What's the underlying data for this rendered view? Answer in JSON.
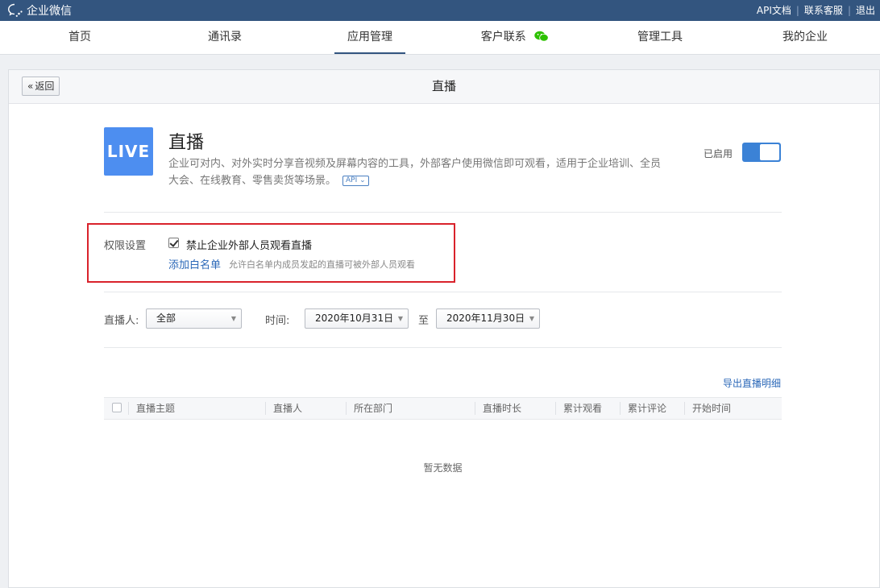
{
  "topbar": {
    "brand": "企业微信",
    "links": [
      "API文档",
      "联系客服",
      "退出"
    ]
  },
  "nav": {
    "items": [
      "首页",
      "通讯录",
      "应用管理",
      "客户联系",
      "管理工具",
      "我的企业"
    ],
    "active": "应用管理"
  },
  "header": {
    "back_label": "返回",
    "title": "直播"
  },
  "app": {
    "icon_text": "LIVE",
    "name": "直播",
    "description": "企业可对内、对外实时分享音视频及屏幕内容的工具，外部客户使用微信即可观看，适用于企业培训、全员大会、在线教育、零售卖货等场景。",
    "api_badge": "API",
    "status_label": "已启用",
    "enabled": true
  },
  "permission": {
    "label": "权限设置",
    "checkbox_label": "禁止企业外部人员观看直播",
    "checked": true,
    "whitelist_link": "添加白名单",
    "whitelist_hint": "允许白名单内成员发起的直播可被外部人员观看"
  },
  "filters": {
    "streamer_label": "直播人:",
    "streamer_value": "全部",
    "time_label": "时间:",
    "start_date": "2020年10月31日",
    "to_label": "至",
    "end_date": "2020年11月30日"
  },
  "export_label": "导出直播明细",
  "table": {
    "columns": [
      "直播主题",
      "直播人",
      "所在部门",
      "直播时长",
      "累计观看",
      "累计评论",
      "开始时间"
    ],
    "empty_text": "暂无数据"
  },
  "colors": {
    "topbar": "#33557f",
    "accent": "#3b82d6",
    "link": "#2b68b8",
    "highlight_box": "#d9222b",
    "live_icon": "#4d8ef0",
    "wechat_green": "#2dc100"
  }
}
